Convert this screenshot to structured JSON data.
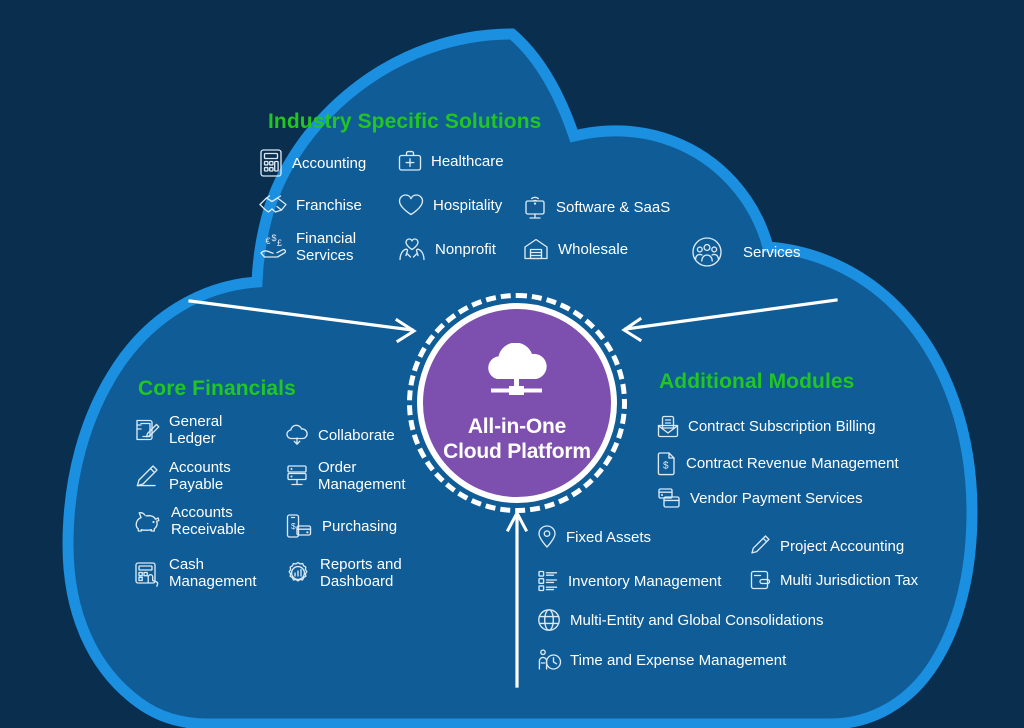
{
  "diagram": {
    "title_center": "All-in-One\nCloud Platform",
    "center_icon": "cloud-network-icon",
    "colors": {
      "background": "#0a2e4d",
      "cloud_fill": "#0f5c96",
      "cloud_outline": "#1b8fe0",
      "heading_green": "#22c522",
      "center_purple": "#7d4faf",
      "text_white": "#ffffff"
    }
  },
  "sections": {
    "industry": {
      "heading": "Industry Specific Solutions",
      "items": [
        {
          "label": "Accounting",
          "icon": "calculator-icon"
        },
        {
          "label": "Healthcare",
          "icon": "medical-briefcase-icon"
        },
        {
          "label": "Franchise",
          "icon": "handshake-icon"
        },
        {
          "label": "Hospitality",
          "icon": "heart-icon"
        },
        {
          "label": "Software & SaaS",
          "icon": "monitor-wifi-icon"
        },
        {
          "label": "Financial\nServices",
          "icon": "hand-currency-icon"
        },
        {
          "label": "Nonprofit",
          "icon": "hands-heart-icon"
        },
        {
          "label": "Wholesale",
          "icon": "warehouse-icon"
        },
        {
          "label": "Services",
          "icon": "people-group-icon"
        }
      ]
    },
    "core_financials": {
      "heading": "Core Financials",
      "items": [
        {
          "label": "General\nLedger",
          "icon": "ledger-pencil-icon"
        },
        {
          "label": "Collaborate",
          "icon": "cloud-download-icon"
        },
        {
          "label": "Accounts\nPayable",
          "icon": "pencil-icon"
        },
        {
          "label": "Order\nManagement",
          "icon": "server-screen-icon"
        },
        {
          "label": "Accounts\nReceivable",
          "icon": "piggy-bank-icon"
        },
        {
          "label": "Purchasing",
          "icon": "mobile-payment-icon"
        },
        {
          "label": "Cash\nManagement",
          "icon": "cash-register-hand-icon"
        },
        {
          "label": "Reports and\nDashboard",
          "icon": "gear-report-icon"
        }
      ]
    },
    "additional_modules": {
      "heading": "Additional Modules",
      "items": [
        {
          "label": "Contract Subscription Billing",
          "icon": "envelope-document-icon"
        },
        {
          "label": "Contract Revenue Management",
          "icon": "dollar-document-icon"
        },
        {
          "label": "Vendor Payment Services",
          "icon": "card-stack-icon"
        },
        {
          "label": "Fixed Assets",
          "icon": "location-pin-icon"
        },
        {
          "label": "Project Accounting",
          "icon": "pen-icon"
        },
        {
          "label": "Inventory Management",
          "icon": "checklist-icon"
        },
        {
          "label": "Multi Jurisdiction Tax",
          "icon": "wallet-icon"
        },
        {
          "label": "Multi-Entity and Global Consolidations",
          "icon": "globe-icon"
        },
        {
          "label": "Time and Expense Management",
          "icon": "person-clock-icon"
        }
      ]
    }
  },
  "arrows": [
    {
      "name": "arrow-from-core-financials",
      "direction": "right"
    },
    {
      "name": "arrow-from-additional-modules",
      "direction": "left"
    },
    {
      "name": "arrow-from-bottom-modules",
      "direction": "up"
    }
  ]
}
